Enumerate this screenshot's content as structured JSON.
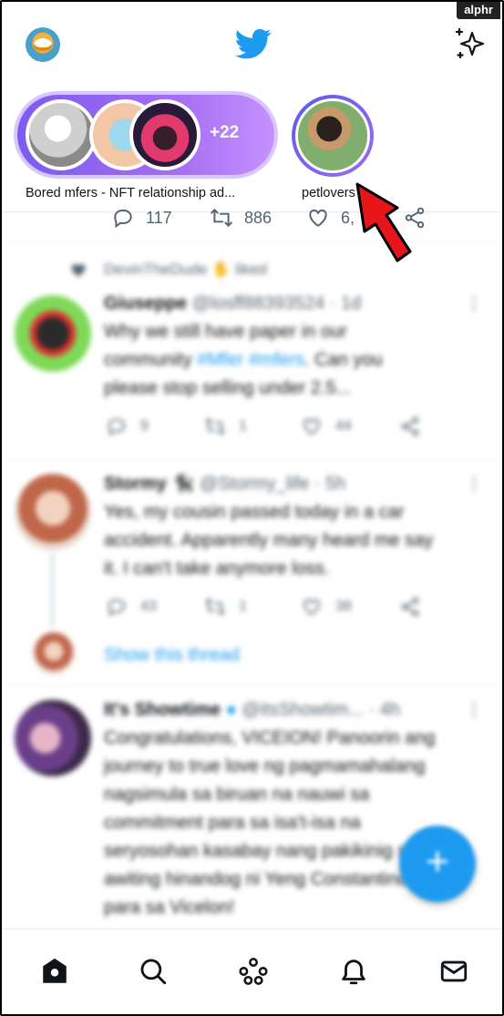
{
  "watermark": "alphr",
  "header": {
    "avatar_icon": "garfield-avatar",
    "logo_icon": "twitter-bird-icon",
    "sparkle_icon": "sparkle-icon",
    "brand_color": "#1d9bf0"
  },
  "fleets": {
    "group": {
      "label": "Bored mfers - NFT relationship ad...",
      "count": "+22"
    },
    "single": {
      "label": "petlovers"
    }
  },
  "top_actions": {
    "reply_count": "117",
    "retweet_count": "886",
    "like_count": "6,"
  },
  "feed": {
    "liked_by": "DevinTheDude",
    "liked_suffix": "liked",
    "tweets": [
      {
        "name": "Giuseppe",
        "handle": "@losff88393524 · 1d",
        "text_1": "Why we still have paper in our",
        "text_2_pre": "community ",
        "text_2_tags": "#Mfer #mfers",
        "text_2_post": ". Can you",
        "text_3": "please stop selling under 2.5...",
        "replies": "9",
        "retweets": "1",
        "likes": "44"
      },
      {
        "name": "Stormy 🐈‍⬛",
        "handle": "@Stormy_life · 5h",
        "text_1": "Yes, my cousin passed today in a car",
        "text_2": "accident. Apparently many heard me say",
        "text_3": "it. I can't take anymore loss.",
        "replies": "43",
        "retweets": "1",
        "likes": "38",
        "thread_link": "Show this thread"
      },
      {
        "name": "It's Showtime",
        "handle": "@itsShowtim... · 4h",
        "lines": [
          "Congratulations, VICEION! Panoorin ang",
          "journey to true love ng pagmamahalang",
          "nagsimula sa biruan na nauwi sa",
          "commitment para sa isa't-isa na",
          "seryosohan kasabay nang pakikinig sa",
          "awiting hinandog ni Yeng Constantino",
          "para sa Vicelon!"
        ]
      }
    ]
  },
  "fab": {
    "label": "+"
  },
  "bottom_nav": [
    "home-icon",
    "search-icon",
    "spaces-icon",
    "notifications-icon",
    "messages-icon"
  ]
}
